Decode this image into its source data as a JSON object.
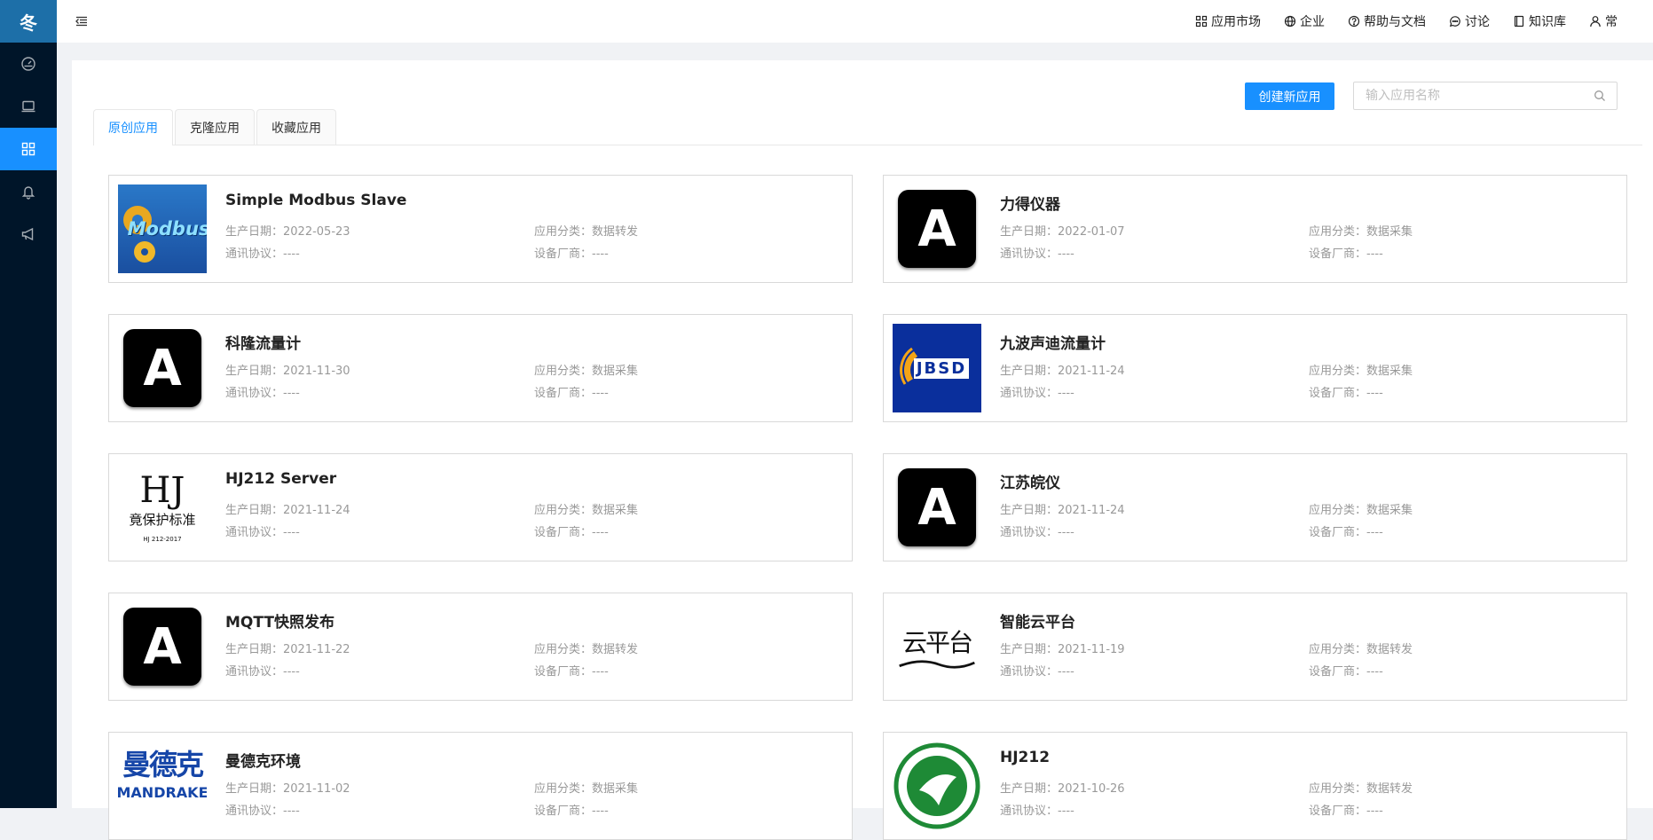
{
  "brand": {
    "logo_text": "冬"
  },
  "sidebar": {
    "items": [
      {
        "icon": "dashboard-icon"
      },
      {
        "icon": "monitor-icon"
      },
      {
        "icon": "apps-grid-icon",
        "active": true
      },
      {
        "icon": "bell-icon"
      },
      {
        "icon": "megaphone-icon"
      }
    ]
  },
  "topbar": {
    "nav": [
      {
        "label": "应用市场",
        "icon": "apps-grid-icon"
      },
      {
        "label": "企业",
        "icon": "globe-icon"
      },
      {
        "label": "帮助与文档",
        "icon": "question-circle-icon"
      },
      {
        "label": "讨论",
        "icon": "chat-bubble-icon"
      },
      {
        "label": "知识库",
        "icon": "book-icon"
      },
      {
        "label": "常",
        "icon": "user-icon"
      }
    ]
  },
  "toolbar": {
    "create_label": "创建新应用",
    "search_placeholder": "输入应用名称",
    "search_value": ""
  },
  "tabs": [
    {
      "label": "原创应用",
      "active": true
    },
    {
      "label": "克隆应用",
      "active": false
    },
    {
      "label": "收藏应用",
      "active": false
    }
  ],
  "field_labels": {
    "date": "生产日期：",
    "protocol": "通讯协议：",
    "category": "应用分类：",
    "vendor": "设备厂商："
  },
  "apps": [
    {
      "name": "Simple Modbus Slave",
      "date": "2022-05-23",
      "protocol": "----",
      "category": "数据转发",
      "vendor": "----",
      "logo": "modbus",
      "logo_text": "Modbus"
    },
    {
      "name": "力得仪器",
      "date": "2022-01-07",
      "protocol": "----",
      "category": "数据采集",
      "vendor": "----",
      "logo": "A",
      "logo_text": "A"
    },
    {
      "name": "科隆流量计",
      "date": "2021-11-30",
      "protocol": "----",
      "category": "数据采集",
      "vendor": "----",
      "logo": "A",
      "logo_text": "A"
    },
    {
      "name": "九波声迪流量计",
      "date": "2021-11-24",
      "protocol": "----",
      "category": "数据采集",
      "vendor": "----",
      "logo": "jbsd",
      "logo_text": "JBSD"
    },
    {
      "name": "HJ212 Server",
      "date": "2021-11-24",
      "protocol": "----",
      "category": "数据采集",
      "vendor": "----",
      "logo": "hj",
      "logo_text": "HJ",
      "logo_sub": "竟保护标准",
      "logo_small": "HJ 212-2017"
    },
    {
      "name": "江苏皖仪",
      "date": "2021-11-24",
      "protocol": "----",
      "category": "数据采集",
      "vendor": "----",
      "logo": "A",
      "logo_text": "A"
    },
    {
      "name": "MQTT快照发布",
      "date": "2021-11-22",
      "protocol": "----",
      "category": "数据转发",
      "vendor": "----",
      "logo": "A",
      "logo_text": "A"
    },
    {
      "name": "智能云平台",
      "date": "2021-11-19",
      "protocol": "----",
      "category": "数据转发",
      "vendor": "----",
      "logo": "cloud",
      "logo_text": "云平台"
    },
    {
      "name": "曼德克环境",
      "date": "2021-11-02",
      "protocol": "----",
      "category": "数据采集",
      "vendor": "----",
      "logo": "mdk",
      "logo_text": "曼德克",
      "logo_sub": "MANDRAKE"
    },
    {
      "name": "HJ212",
      "date": "2021-10-26",
      "protocol": "----",
      "category": "数据转发",
      "vendor": "----",
      "logo": "green",
      "logo_text": ""
    }
  ]
}
